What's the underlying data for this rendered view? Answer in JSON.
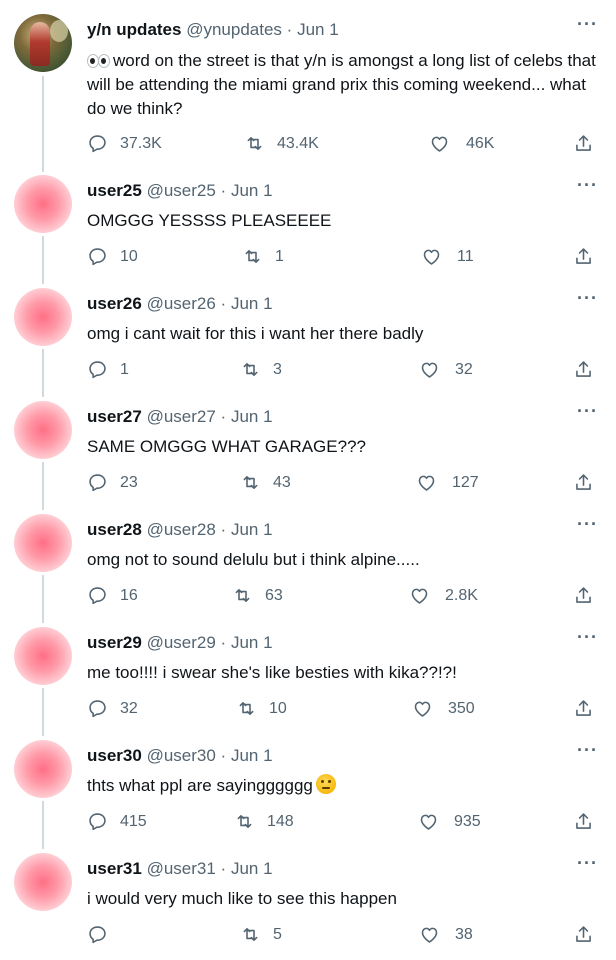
{
  "main_tweet": {
    "display_name": "y/n updates",
    "handle": "@ynupdates",
    "date": "Jun 1",
    "text": "word on the street is that y/n is amongst a long list of celebs that will be attending the miami grand prix this coming weekend... what do we think?",
    "replies": "37.3K",
    "retweets": "43.4K",
    "likes": "46K"
  },
  "replies": [
    {
      "display_name": "user25",
      "handle": "@user25",
      "date": "Jun 1",
      "text": "OMGGG YESSSS PLEASEEEE",
      "replies": "10",
      "retweets": "1",
      "likes": "11"
    },
    {
      "display_name": "user26",
      "handle": "@user26",
      "date": "Jun 1",
      "text": "omg i cant wait for this i want her there badly",
      "replies": "1",
      "retweets": "3",
      "likes": "32"
    },
    {
      "display_name": "user27",
      "handle": "@user27",
      "date": "Jun 1",
      "text": "SAME OMGGG WHAT GARAGE???",
      "replies": "23",
      "retweets": "43",
      "likes": "127"
    },
    {
      "display_name": "user28",
      "handle": "@user28",
      "date": "Jun 1",
      "text": "omg not to sound delulu but i think alpine.....",
      "replies": "16",
      "retweets": "63",
      "likes": "2.8K"
    },
    {
      "display_name": "user29",
      "handle": "@user29",
      "date": "Jun 1",
      "text": "me too!!!! i swear she's like besties with kika??!?!",
      "replies": "32",
      "retweets": "10",
      "likes": "350"
    },
    {
      "display_name": "user30",
      "handle": "@user30",
      "date": "Jun 1",
      "text": "thts what ppl are sayingggggg",
      "replies": "415",
      "retweets": "148",
      "likes": "935"
    },
    {
      "display_name": "user31",
      "handle": "@user31",
      "date": "Jun 1",
      "text": "i would very much like to see this happen",
      "replies": "",
      "retweets": "5",
      "likes": "38"
    }
  ],
  "separator": "·",
  "more_glyph": "···",
  "icons": {
    "reply": "reply-icon",
    "retweet": "retweet-icon",
    "like": "heart-icon",
    "share": "share-icon",
    "more": "more-icon",
    "emoji_eyes": "eyes-emoji",
    "emoji_thinking": "thinking-emoji"
  },
  "colors": {
    "text": "#0f1419",
    "secondary": "#536471",
    "thread_line": "#cfd9de",
    "avatar_pink": "#ff6f85"
  }
}
